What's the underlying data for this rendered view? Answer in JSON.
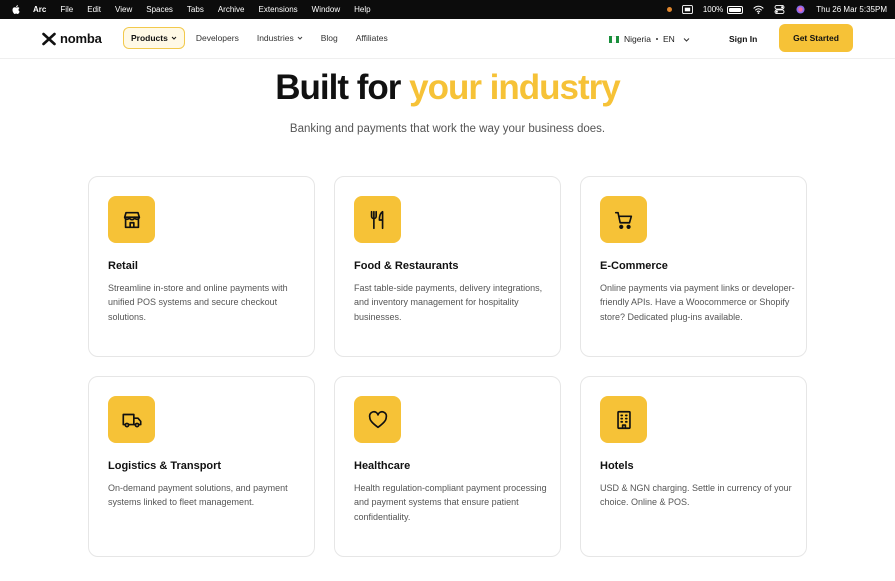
{
  "menubar": {
    "app": "Arc",
    "items": [
      "File",
      "Edit",
      "View",
      "Spaces",
      "Tabs",
      "Archive",
      "Extensions",
      "Window",
      "Help"
    ],
    "battery": "100%",
    "datetime": "Thu 26 Mar  5:35PM"
  },
  "header": {
    "logo_text": "nomba",
    "nav": [
      {
        "label": "Products"
      },
      {
        "label": "Developers"
      },
      {
        "label": "Industries"
      },
      {
        "label": "Blog"
      },
      {
        "label": "Affiliates"
      }
    ],
    "country": "Nigeria",
    "language": "EN",
    "signin": "Sign In",
    "cta": "Get Started"
  },
  "hero": {
    "title_plain": "Built for ",
    "title_accent": "your industry",
    "subtitle": "Banking and payments that work the way your business does."
  },
  "cards": [
    {
      "icon": "store-icon",
      "title": "Retail",
      "description": "Streamline in-store and online payments with unified POS systems and secure checkout solutions."
    },
    {
      "icon": "fork-knife-icon",
      "title": "Food & Restaurants",
      "description": "Fast table-side payments, delivery integrations, and inventory management for hospitality businesses."
    },
    {
      "icon": "cart-icon",
      "title": "E-Commerce",
      "description": "Online payments via payment links or developer-friendly APIs. Have a Woocommerce or Shopify store? Dedicated plug-ins available."
    },
    {
      "icon": "truck-icon",
      "title": "Logistics & Transport",
      "description": "On-demand payment solutions, and payment systems linked to fleet management."
    },
    {
      "icon": "heart-icon",
      "title": "Healthcare",
      "description": "Health regulation-compliant payment processing and payment systems that ensure patient confidentiality."
    },
    {
      "icon": "building-icon",
      "title": "Hotels",
      "description": "USD & NGN charging. Settle in currency of your choice. Online & POS."
    }
  ],
  "colors": {
    "accent": "#f6c237",
    "text": "#111111",
    "muted": "#555555"
  }
}
